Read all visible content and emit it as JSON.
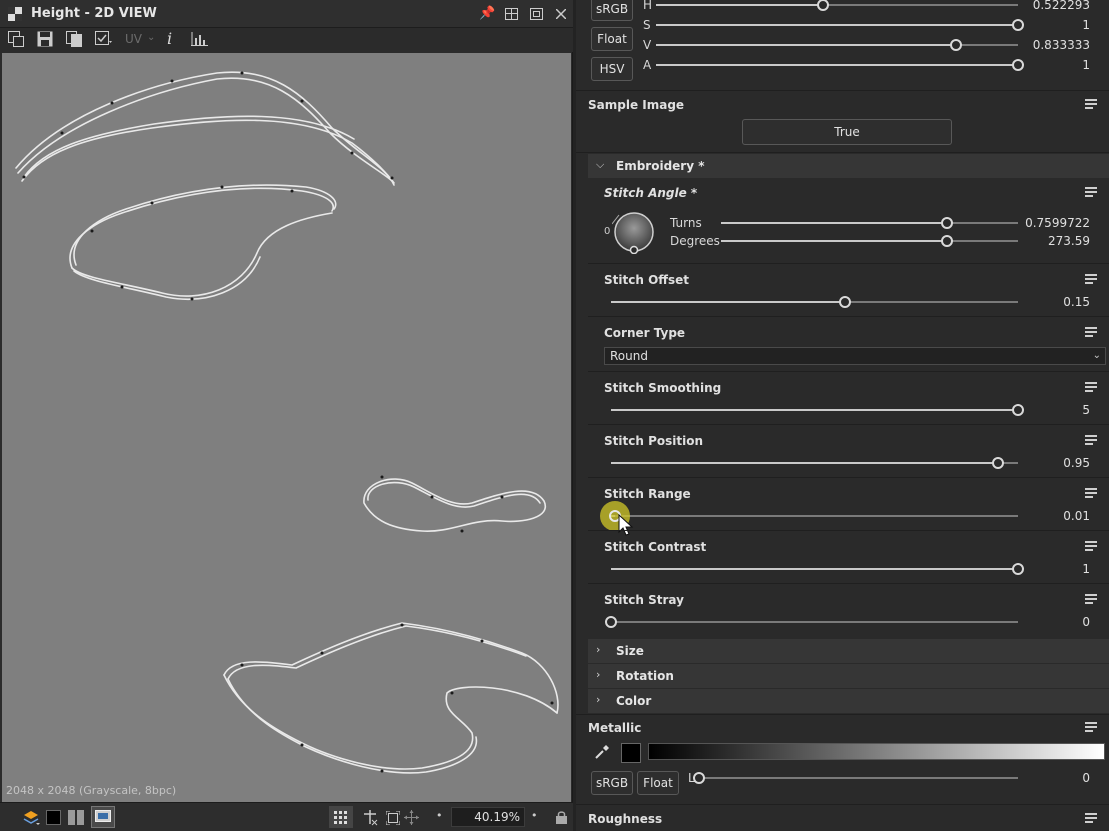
{
  "view": {
    "title": "Height - 2D VIEW",
    "toolbar_uv": "UV",
    "status": "2048 x 2048 (Grayscale, 8bpc)",
    "zoom": "40.19%"
  },
  "color_block": {
    "buttons": [
      "sRGB",
      "Float",
      "HSV"
    ],
    "channels": [
      {
        "label": "H",
        "value": "0.522293",
        "frac": 0.46
      },
      {
        "label": "S",
        "value": "1",
        "frac": 1.0
      },
      {
        "label": "V",
        "value": "0.833333",
        "frac": 0.83
      },
      {
        "label": "A",
        "value": "1",
        "frac": 1.0
      }
    ]
  },
  "sample_image": {
    "title": "Sample Image",
    "button": "True"
  },
  "embroidery": {
    "header": "Embroidery *",
    "stitch_angle": {
      "title": "Stitch Angle *",
      "zero": "0",
      "turns_label": "Turns",
      "turns_value": "0.7599722",
      "turns_frac": 0.76,
      "degrees_label": "Degrees",
      "degrees_value": "273.59",
      "degrees_frac": 0.76
    },
    "stitch_offset": {
      "title": "Stitch Offset",
      "value": "0.15",
      "frac": 0.575
    },
    "corner_type": {
      "title": "Corner Type",
      "selected": "Round"
    },
    "stitch_smoothing": {
      "title": "Stitch Smoothing",
      "value": "5",
      "frac": 1.0
    },
    "stitch_position": {
      "title": "Stitch Position",
      "value": "0.95",
      "frac": 0.95
    },
    "stitch_range": {
      "title": "Stitch Range",
      "value": "0.01",
      "frac": 0.01
    },
    "stitch_contrast": {
      "title": "Stitch Contrast",
      "value": "1",
      "frac": 1.0
    },
    "stitch_stray": {
      "title": "Stitch Stray",
      "value": "0",
      "frac": 0.0
    }
  },
  "collapsed_groups": [
    "Size",
    "Rotation",
    "Color"
  ],
  "metallic": {
    "title": "Metallic",
    "buttons": [
      "sRGB",
      "Float"
    ],
    "l_label": "L",
    "value": "0",
    "frac": 0.0
  },
  "roughness": {
    "title": "Roughness"
  }
}
